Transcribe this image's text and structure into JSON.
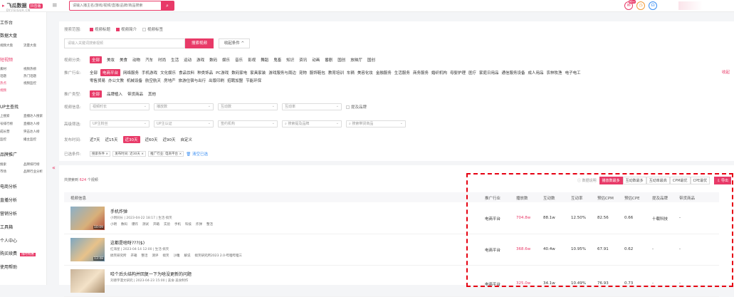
{
  "topbar": {
    "logo_text": "飞瓜数据",
    "logo_tag": "抖音版",
    "logo_sub": "DY.FEIGUA.CN",
    "search_placeholder": "请输入播主名/游戏/视频/直播/品牌/商品搜索",
    "notif_badge": "99+"
  },
  "sidebar": {
    "items": [
      {
        "label": "工作台",
        "subs": []
      },
      {
        "label": "数据大盘",
        "subs": [
          "视频大盘",
          "流量大盘"
        ]
      },
      {
        "label": "短视频",
        "subs": [
          "素材",
          "视频热榜",
          "话题",
          "热门话题",
          "热点",
          "视频监控",
          "视频"
        ]
      },
      {
        "label": "UP主查找",
        "subs": [
          "上搜索",
          "直播达人搜索",
          "号排行榜",
          "直播达人榜",
          "成长营",
          "突击达人榜",
          "监控",
          "播主监控"
        ]
      },
      {
        "label": "品牌推广",
        "subs": [
          "搜索",
          "品牌排行榜",
          "市场",
          "品牌行业分析"
        ]
      },
      {
        "label": "电商分析",
        "subs": []
      },
      {
        "label": "直播分析",
        "subs": []
      },
      {
        "label": "营销分析",
        "subs": []
      },
      {
        "label": "工具箱",
        "subs": []
      },
      {
        "label": "个人中心",
        "subs": []
      },
      {
        "label": "购买续费",
        "subs": []
      },
      {
        "label": "使用帮助",
        "subs": []
      }
    ],
    "vip_tag": "限时特惠"
  },
  "filters": {
    "search_scope_label": "搜索范围:",
    "scope_options": [
      {
        "label": "视频标题",
        "checked": true
      },
      {
        "label": "视频简介",
        "checked": true
      },
      {
        "label": "视频标签",
        "checked": false
      }
    ],
    "keyword_placeholder": "请输入关键词搜索视频",
    "search_button": "搜索视频",
    "collapse_button": "收起条件 ^",
    "category_label": "视频分类:",
    "categories": [
      "全部",
      "美妆",
      "美食",
      "动物",
      "汽车",
      "时尚",
      "生活",
      "运动",
      "游戏",
      "数码",
      "娱乐",
      "音乐",
      "影视",
      "舞蹈",
      "鬼畜",
      "知识",
      "资讯",
      "动画",
      "番剧",
      "国创",
      "放映厅",
      "国创"
    ],
    "industry_label": "推广行业:",
    "industries": [
      "全部",
      "电商平台",
      "网络服务",
      "手机游戏",
      "文化娱乐",
      "食品饮料",
      "种类饰品",
      "PC游戏",
      "数码家电",
      "家具家装",
      "游戏服务与周边",
      "宠物",
      "服饰鞋包",
      "教育培训",
      "车辆",
      "美容化妆",
      "金融服务",
      "生活服务",
      "商务服务",
      "婚织机构",
      "母婴护理",
      "医疗",
      "家庭日用品",
      "通信服务设备",
      "成人用品",
      "农林牧渔",
      "电子电工"
    ],
    "industries_row2": [
      "零售贸易",
      "办公文教",
      "机械设备",
      "航空航天",
      "房地产",
      "旅游住宿与出行",
      "出版印刷",
      "招聘加盟",
      "节能环保"
    ],
    "industry_more": "收起",
    "promo_type_label": "推广类型:",
    "promo_types": [
      "全部",
      "品牌植入",
      "带货商品",
      "其他"
    ],
    "video_info_label": "视频信息:",
    "video_info_selects": [
      "视频时长",
      "播放数",
      "互动数",
      "互动率"
    ],
    "brand_check": "提及品牌",
    "advanced_label": "高级筛选:",
    "advanced_selects": [
      "UP主粉丝",
      "UP主认证",
      "签约机构"
    ],
    "advanced_inputs": [
      "搜索提及品牌",
      "搜索带货商品"
    ],
    "time_label": "发布时间:",
    "time_options": [
      "近7天",
      "近15天",
      "近30天",
      "近60天",
      "近90天",
      "自定义"
    ],
    "selected_label": "已选条件:",
    "selected_chips": [
      "搜索条件 ×",
      "发布时间: 近30天 ×",
      "推广行业: 电商平台 ×"
    ],
    "clear_label": "清空已选"
  },
  "results": {
    "count_prefix": "共搜索到",
    "count": "624",
    "count_suffix": "个视频",
    "sort_hint": "数据说明",
    "sort_options": [
      {
        "label": "播放数最多",
        "on": true
      },
      {
        "label": "互动数最多",
        "on": false
      },
      {
        "label": "互动率最高",
        "on": false
      },
      {
        "label": "CPM最优",
        "on": false
      },
      {
        "label": "CPE最优",
        "on": false
      }
    ],
    "export_label": "导出",
    "columns": [
      "视频信息",
      "推广行业",
      "播放数",
      "互动数",
      "互动率",
      "预估CPM",
      "预估CPE",
      "提及品牌",
      "带货商品"
    ],
    "rows": [
      {
        "duration": "10:09",
        "title": "手机炸弹",
        "meta": "小明同长 | 2023-04-22 18:17 | 生活·搞笑",
        "tags": [
          "小明",
          "数码",
          "爆炸",
          "测试",
          "开箱",
          "实验",
          "手机",
          "科技",
          "炸弹",
          "整活"
        ],
        "industry": "电商平台",
        "plays": "704.8w",
        "interactions": "88.1w",
        "rate": "12.50%",
        "cpm": "82.56",
        "cpe": "0.66",
        "brand": "十载科技",
        "goods": "-"
      },
      {
        "duration": "13:48",
        "title": "这都是啥呀???($)",
        "meta": "红海星 | 2023-04-14 12:00 | 生活·搞笑",
        "tags": [
          "搞笑研究所",
          "开箱",
          "整活",
          "测评",
          "搞笑",
          "沙雕",
          "解说",
          "搞笑研究所2023 2.0·哔哩哔哩三"
        ],
        "industry": "电商平台",
        "plays": "368.6w",
        "interactions": "40.4w",
        "rate": "10.95%",
        "cpm": "67.91",
        "cpe": "0.62",
        "brand": "-",
        "goods": "-"
      },
      {
        "duration": "",
        "title": "哈个后头结构并回复一下为啥没更新的问题",
        "meta": "刘德宇漫文研究 | 2023-04-23 15:00 | 美食·美食制作",
        "tags": [],
        "industry": "电商平台",
        "plays": "325.0w",
        "interactions": "34.1w",
        "rate": "10.49%",
        "cpm": "76.93",
        "cpe": "0.73",
        "brand": "-",
        "goods": "-"
      }
    ]
  },
  "colors": {
    "accent": "#e83a68",
    "highlight_box": "#e60012",
    "link": "#3a8ef2"
  }
}
